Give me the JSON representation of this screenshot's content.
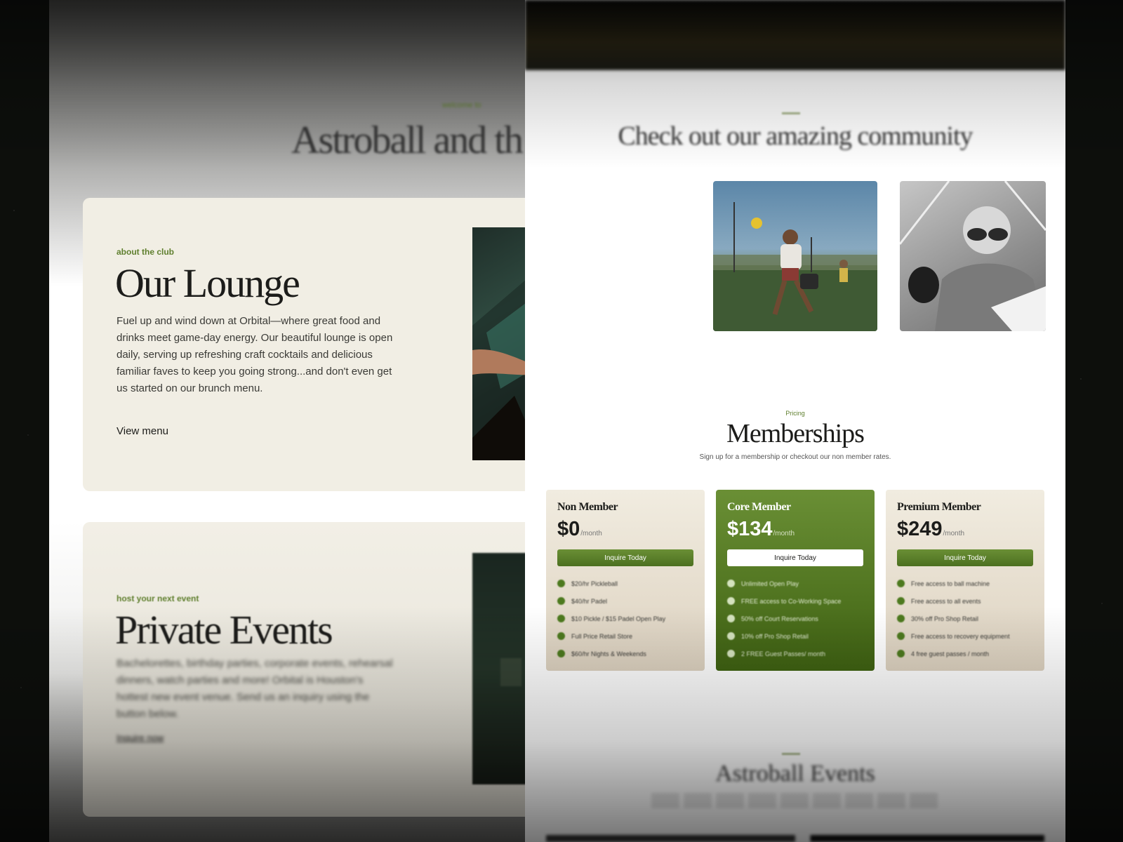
{
  "left": {
    "kicker": "welcome to",
    "title": "Astroball and th",
    "lounge": {
      "kicker": "about the club",
      "heading": "Our Lounge",
      "body": "Fuel up and wind down at Orbital—where great food and drinks meet game-day energy. Our beautiful lounge is open daily, serving up refreshing craft cocktails and delicious familiar faves to keep you going strong...and don't even get us started on our brunch menu.",
      "link": "View menu"
    },
    "events": {
      "kicker": "host your next event",
      "heading": "Private Events",
      "body": "Bachelorettes, birthday parties, corporate events, rehearsal dinners, watch parties and more! Orbital is Houston's hottest new event venue. Send us an inquiry using the button below.",
      "link": "Inquire now"
    }
  },
  "right": {
    "community_title": "Check out our amazing community",
    "pricing_kicker": "Pricing",
    "memberships_title": "Memberships",
    "memberships_sub": "Sign up for a membership or checkout our non member rates.",
    "plans": [
      {
        "name": "Non Member",
        "price": "$0",
        "per": "/month",
        "button": "Inquire Today",
        "features": [
          "$20/hr Pickleball",
          "$40/hr Padel",
          "$10 Pickle / $15 Padel Open Play",
          "Full Price Retail Store",
          "$60/hr Nights & Weekends"
        ]
      },
      {
        "name": "Core Member",
        "price": "$134",
        "per": "/month",
        "button": "Inquire Today",
        "features": [
          "Unlimited Open Play",
          "FREE access to Co-Working Space",
          "50% off Court Reservations",
          "10% off Pro Shop Retail",
          "2 FREE Guest Passes/ month"
        ]
      },
      {
        "name": "Premium Member",
        "price": "$249",
        "per": "/month",
        "button": "Inquire Today",
        "features": [
          "Free access to ball machine",
          "Free access to all events",
          "30% off Pro Shop Retail",
          "Free access to recovery equipment",
          "4 free guest passes / month"
        ]
      }
    ],
    "events_title": "Astroball Events"
  },
  "colors": {
    "accent_green": "#4d7a1f",
    "kicker_green": "#5f7f2e",
    "cream": "#f1eee4",
    "dark_bg": "#0d0f0c"
  }
}
